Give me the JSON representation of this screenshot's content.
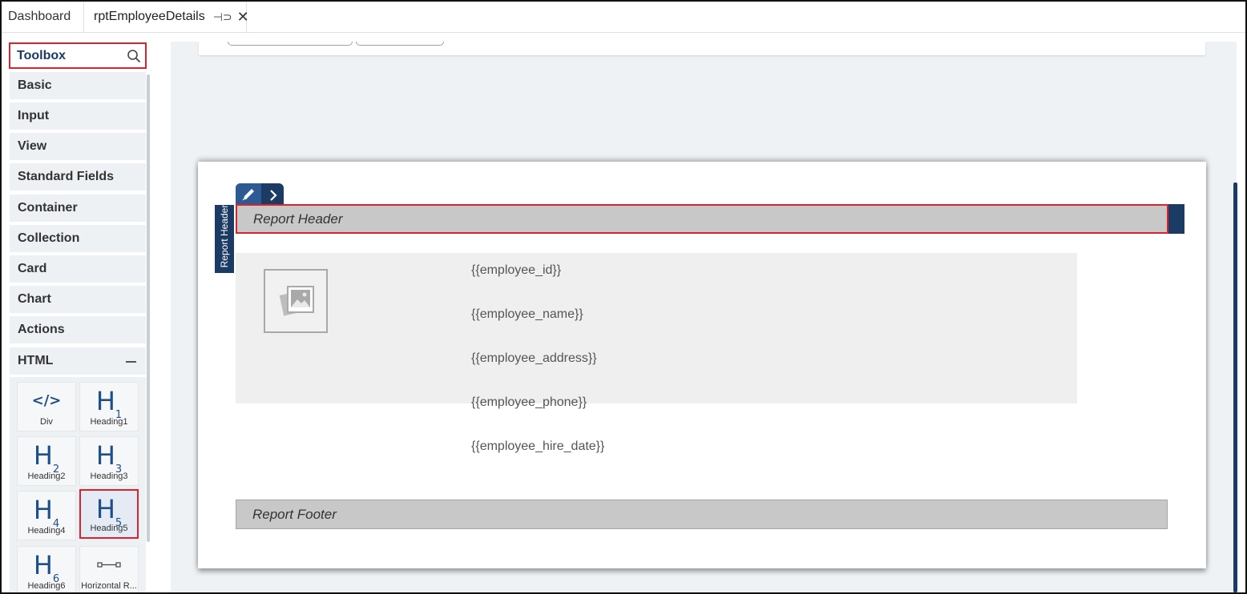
{
  "tabs": {
    "dashboard": "Dashboard",
    "active": "rptEmployeeDetails"
  },
  "toolbox": {
    "title": "Toolbox",
    "categories": [
      "Basic",
      "Input",
      "View",
      "Standard Fields",
      "Container",
      "Collection",
      "Card",
      "Chart",
      "Actions",
      "HTML"
    ],
    "html_items": [
      {
        "label": "Div",
        "icon": "div-icon"
      },
      {
        "label": "Heading1",
        "icon": "heading1-icon"
      },
      {
        "label": "Heading2",
        "icon": "heading2-icon"
      },
      {
        "label": "Heading3",
        "icon": "heading3-icon"
      },
      {
        "label": "Heading4",
        "icon": "heading4-icon"
      },
      {
        "label": "Heading5",
        "icon": "heading5-icon",
        "selected": true
      },
      {
        "label": "Heading6",
        "icon": "heading6-icon"
      },
      {
        "label": "Horizontal R...",
        "icon": "horizontal-rule-icon"
      }
    ]
  },
  "report": {
    "section_label": "Report Header",
    "header_title": "Report Header",
    "footer_title": "Report Footer",
    "fields": [
      "{{employee_id}}",
      "{{employee_name}}",
      "{{employee_address}}",
      "{{employee_phone}}",
      "{{employee_hire_date}}"
    ]
  },
  "colors": {
    "accent": "#1b3a64",
    "highlight": "#d9232e",
    "band": "#c8c8c8"
  }
}
